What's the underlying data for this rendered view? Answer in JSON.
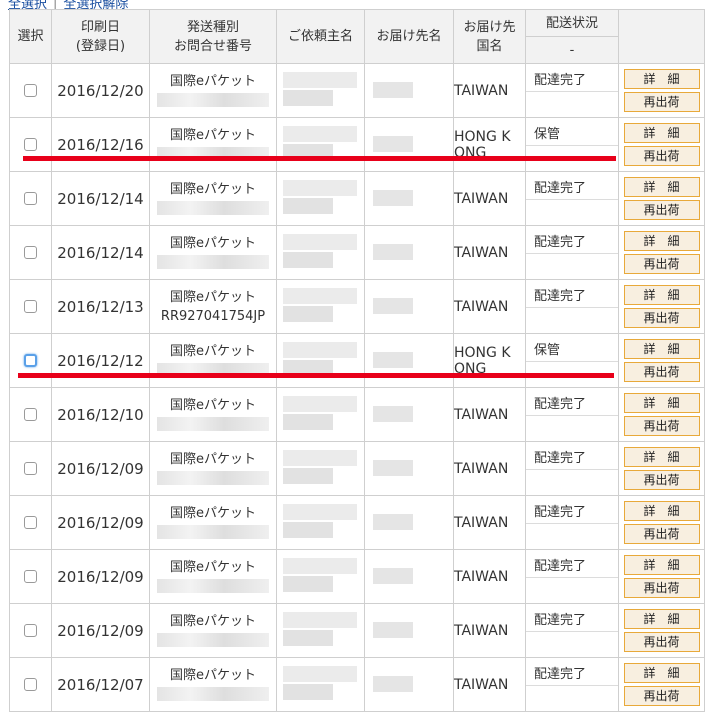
{
  "top_links": {
    "select_all": "全選択",
    "deselect_all": "全選択解除",
    "separator": "|"
  },
  "headers": {
    "select": "選択",
    "print_date_1": "印刷日",
    "print_date_2": "(登録日)",
    "ship_type_1": "発送種別",
    "ship_type_2": "お問合せ番号",
    "client": "ご依頼主名",
    "recipient": "お届け先名",
    "country_1": "お届け先",
    "country_2": "国名",
    "status": "配送状況",
    "status_sub": "-"
  },
  "buttons": {
    "detail": "詳　細",
    "reship": "再出荷"
  },
  "rows": [
    {
      "date": "2016/12/20",
      "type": "国際eパケット",
      "tracking": "",
      "country": "TAIWAN",
      "status": "配達完了",
      "checked": false
    },
    {
      "date": "2016/12/16",
      "type": "国際eパケット",
      "tracking": "",
      "country": "HONG K\nONG",
      "status": "保管",
      "checked": false
    },
    {
      "date": "2016/12/14",
      "type": "国際eパケット",
      "tracking": "",
      "country": "TAIWAN",
      "status": "配達完了",
      "checked": false
    },
    {
      "date": "2016/12/14",
      "type": "国際eパケット",
      "tracking": "",
      "country": "TAIWAN",
      "status": "配達完了",
      "checked": false
    },
    {
      "date": "2016/12/13",
      "type": "国際eパケット",
      "tracking": "RR927041754JP",
      "country": "TAIWAN",
      "status": "配達完了",
      "checked": false
    },
    {
      "date": "2016/12/12",
      "type": "国際eパケット",
      "tracking": "",
      "country": "HONG K\nONG",
      "status": "保管",
      "checked": true
    },
    {
      "date": "2016/12/10",
      "type": "国際eパケット",
      "tracking": "",
      "country": "TAIWAN",
      "status": "配達完了",
      "checked": false
    },
    {
      "date": "2016/12/09",
      "type": "国際eパケット",
      "tracking": "",
      "country": "TAIWAN",
      "status": "配達完了",
      "checked": false
    },
    {
      "date": "2016/12/09",
      "type": "国際eパケット",
      "tracking": "",
      "country": "TAIWAN",
      "status": "配達完了",
      "checked": false
    },
    {
      "date": "2016/12/09",
      "type": "国際eパケット",
      "tracking": "",
      "country": "TAIWAN",
      "status": "配達完了",
      "checked": false
    },
    {
      "date": "2016/12/09",
      "type": "国際eパケット",
      "tracking": "",
      "country": "TAIWAN",
      "status": "配達完了",
      "checked": false
    },
    {
      "date": "2016/12/07",
      "type": "国際eパケット",
      "tracking": "",
      "country": "TAIWAN",
      "status": "配達完了",
      "checked": false
    }
  ],
  "highlight_color": "#e8001a",
  "button_border_color": "#e8a93a"
}
